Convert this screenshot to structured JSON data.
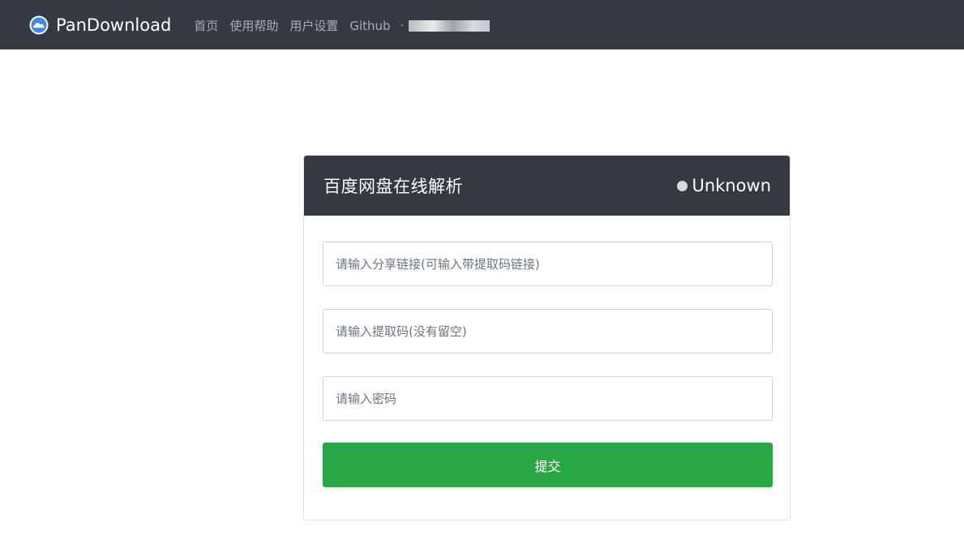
{
  "navbar": {
    "brand": "PanDownload",
    "brand_icon": "cloud-logo-icon",
    "links": [
      {
        "label": "首页"
      },
      {
        "label": "使用帮助"
      },
      {
        "label": "用户设置"
      },
      {
        "label": "Github"
      }
    ],
    "separator": "·"
  },
  "card": {
    "title": "百度网盘在线解析",
    "status": {
      "label": "Unknown",
      "dot_color": "#d6d8da"
    },
    "fields": {
      "share_link_placeholder": "请输入分享链接(可输入带提取码链接)",
      "extract_code_placeholder": "请输入提取码(没有留空)",
      "password_placeholder": "请输入密码"
    },
    "submit_label": "提交"
  },
  "colors": {
    "navbar_bg": "#343a40",
    "submit_bg": "#28a745",
    "logo_blue": "#3d8be0"
  }
}
